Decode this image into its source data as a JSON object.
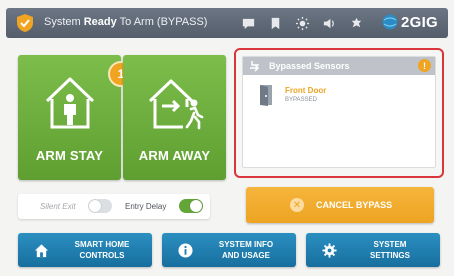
{
  "header": {
    "status_prefix": "System ",
    "status_bold": "Ready",
    "status_suffix": " To Arm (BYPASS)",
    "brand": "2GIG",
    "icons": [
      "message-icon",
      "bookmark-icon",
      "brightness-icon",
      "volume-icon",
      "settings-icon"
    ]
  },
  "arm_stay": {
    "label": "ARM STAY",
    "icon": "house-person-icon"
  },
  "arm_away": {
    "label": "ARM AWAY",
    "icon": "house-exit-icon"
  },
  "bypass_count": "1",
  "bypassed_panel": {
    "title": "Bypassed Sensors",
    "info": "!",
    "sensors": [
      {
        "name": "Front Door",
        "status": "BYPASSED"
      }
    ]
  },
  "toggles": {
    "silent_exit": {
      "label": "Silent Exit",
      "state": "off"
    },
    "entry_delay": {
      "label": "Entry Delay",
      "state": "on"
    }
  },
  "cancel_bypass": {
    "label": "CANCEL BYPASS"
  },
  "bottom_buttons": [
    {
      "line1": "SMART HOME",
      "line2": "CONTROLS",
      "icon": "home-icon"
    },
    {
      "line1": "SYSTEM INFO",
      "line2": "AND USAGE",
      "icon": "info-icon"
    },
    {
      "line1": "SYSTEM",
      "line2": "SETTINGS",
      "icon": "gear-icon"
    }
  ],
  "colors": {
    "header": "#5f6875",
    "arm_green": "#6daf3e",
    "accent_orange": "#f0a421",
    "button_blue": "#1f7fb0",
    "highlight_red": "#d9363c"
  }
}
